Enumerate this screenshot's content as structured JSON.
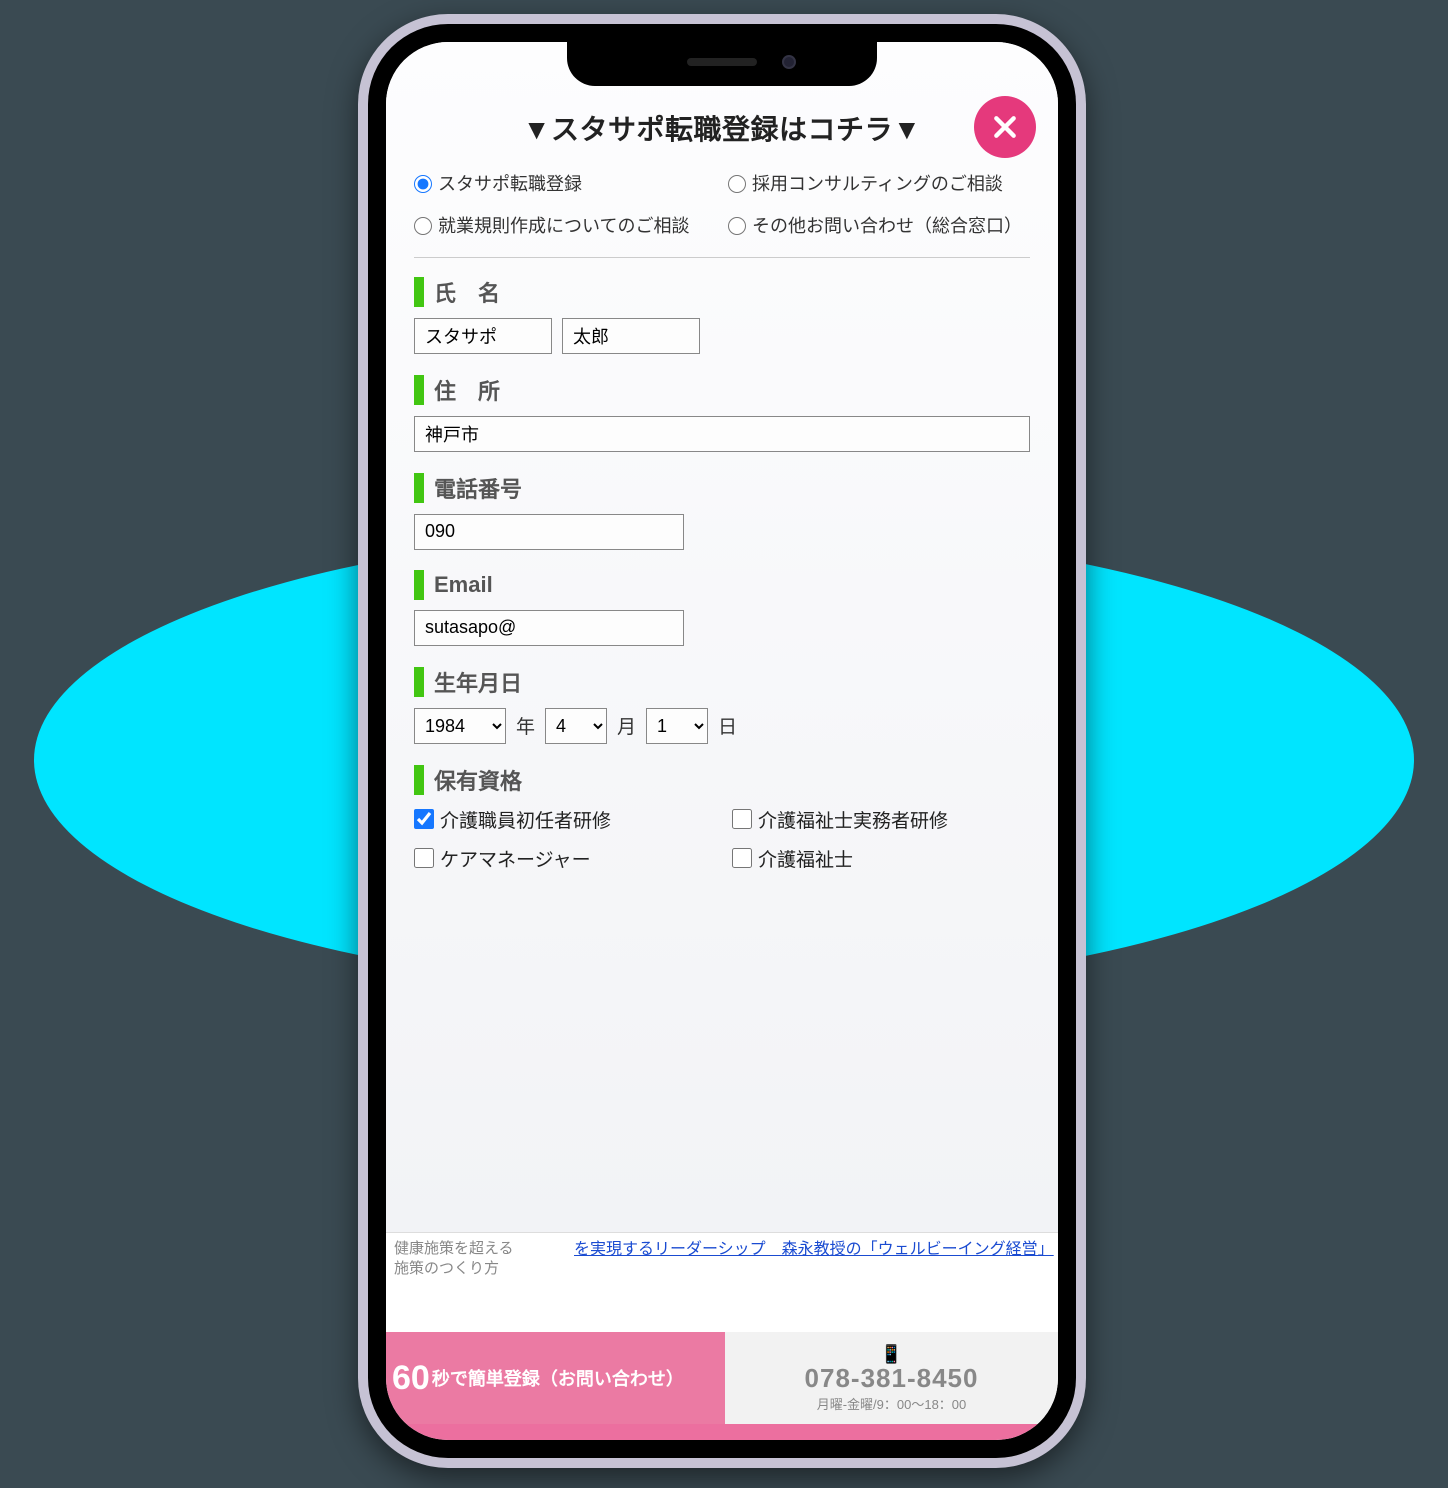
{
  "modal": {
    "title": "▼スタサポ転職登録はコチラ▼",
    "radios": [
      {
        "label": "スタサポ転職登録",
        "checked": true
      },
      {
        "label": "採用コンサルティングのご相談",
        "checked": false
      },
      {
        "label": "就業規則作成についてのご相談",
        "checked": false
      },
      {
        "label": "その他お問い合わせ（総合窓口）",
        "checked": false
      }
    ],
    "fields": {
      "name_label": "氏　名",
      "name_last": "スタサポ",
      "name_first": "太郎",
      "address_label": "住　所",
      "address": "神戸市",
      "phone_label": "電話番号",
      "phone": "090",
      "email_label": "Email",
      "email": "sutasapo@",
      "birth_label": "生年月日",
      "birth_year": "1984",
      "birth_month": "4",
      "birth_day": "1",
      "year_unit": "年",
      "month_unit": "月",
      "day_unit": "日",
      "qual_label": "保有資格",
      "qualifications": [
        {
          "label": "介護職員初任者研修",
          "checked": true
        },
        {
          "label": "介護福祉士実務者研修",
          "checked": false
        },
        {
          "label": "ケアマネージャー",
          "checked": false
        },
        {
          "label": "介護福祉士",
          "checked": false
        }
      ]
    }
  },
  "behind": {
    "left_line1": "健康施策を超える",
    "left_line2": "施策のつくり方",
    "right_text_a": "を実現するリーダーシップ　森永教授の「ウェルビーイング経営」"
  },
  "footer": {
    "left_big": "60",
    "left_rest": "秒で簡単登録（お問い合わせ）",
    "tel": "078-381-8450",
    "hours": "月曜-金曜/9：00〜18：00"
  }
}
